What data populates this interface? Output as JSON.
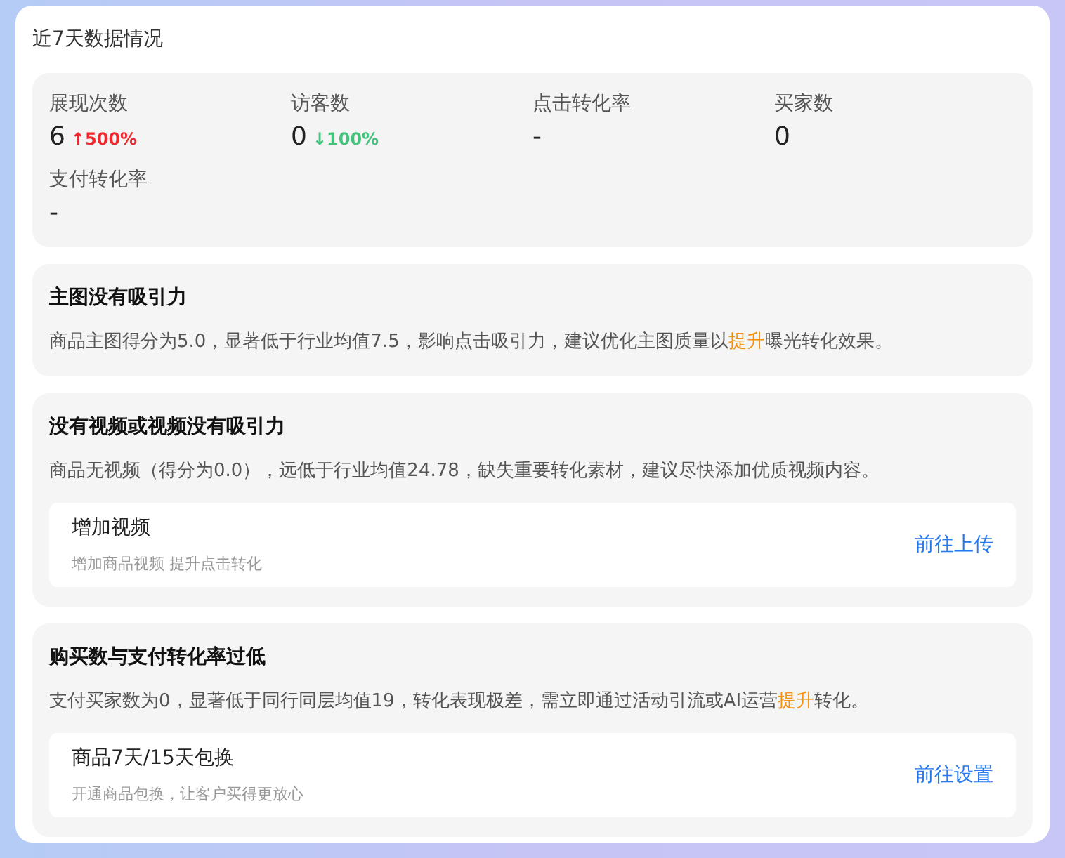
{
  "title": "近7天数据情况",
  "stats": [
    {
      "label": "展现次数",
      "value": "6",
      "trend": {
        "text": "↑500%",
        "up": true
      }
    },
    {
      "label": "访客数",
      "value": "0",
      "trend": {
        "text": "↓100%",
        "up": false
      }
    },
    {
      "label": "点击转化率",
      "value": "-"
    },
    {
      "label": "买家数",
      "value": "0"
    },
    {
      "label": "支付转化率",
      "value": "-"
    }
  ],
  "issues": [
    {
      "title": "主图没有吸引力",
      "description": [
        {
          "text": "商品主图得分为5.0，显著低于行业均值7.5，影响点击吸引力，建议优化主图质量以",
          "highlight": false
        },
        {
          "text": "提升",
          "highlight": true
        },
        {
          "text": "曝光转化效果。",
          "highlight": false
        }
      ]
    },
    {
      "title": "没有视频或视频没有吸引力",
      "description": [
        {
          "text": "商品无视频（得分为0.0），远低于行业均值24.78，缺失重要转化素材，建议尽快添加优质视频内容。",
          "highlight": false
        }
      ],
      "action": {
        "title": "增加视频",
        "subtitle": "增加商品视频 提升点击转化",
        "link": "前往上传"
      }
    },
    {
      "title": "购买数与支付转化率过低",
      "description": [
        {
          "text": "支付买家数为0，显著低于同行同层均值19，转化表现极差，需立即通过活动引流或AI运营",
          "highlight": false
        },
        {
          "text": "提升",
          "highlight": true
        },
        {
          "text": "转化。",
          "highlight": false
        }
      ],
      "action": {
        "title": "商品7天/15天包换",
        "subtitle": "开通商品包换，让客户买得更放心",
        "link": "前往设置"
      }
    }
  ]
}
